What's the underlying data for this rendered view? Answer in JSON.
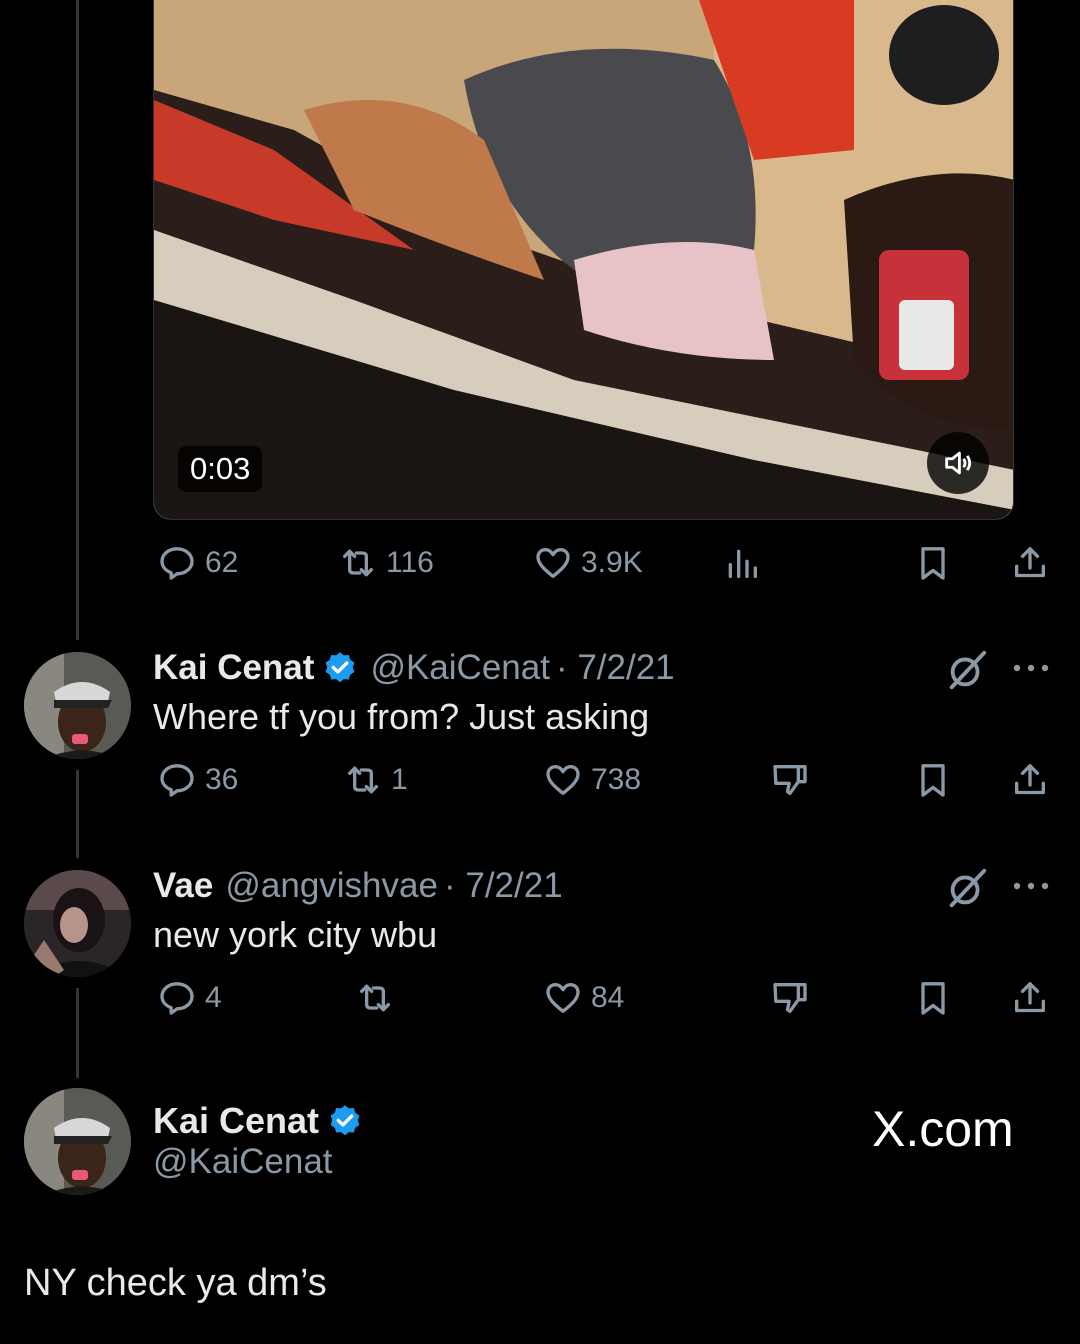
{
  "video": {
    "duration": "0:03"
  },
  "main_tweet": {
    "stats": {
      "replies": "62",
      "retweets": "116",
      "likes": "3.9K"
    }
  },
  "replies": [
    {
      "name": "Kai Cenat",
      "handle": "@KaiCenat",
      "date": "· 7/2/21",
      "verified": true,
      "text": "Where tf you from? Just asking",
      "stats": {
        "replies": "36",
        "retweets": "1",
        "likes": "738"
      }
    },
    {
      "name": "Vae",
      "handle": "@angvishvae",
      "date": "· 7/2/21",
      "verified": false,
      "text": "new york city wbu",
      "stats": {
        "replies": "4",
        "retweets": "",
        "likes": "84"
      }
    }
  ],
  "quote": {
    "name": "Kai Cenat",
    "handle": "@KaiCenat",
    "brand": "X.com",
    "text": "NY check ya dm’s"
  },
  "colors": {
    "background": "#000000",
    "text": "#e7e9ea",
    "muted": "#8b98a5",
    "verified": "#1d9bf0"
  }
}
